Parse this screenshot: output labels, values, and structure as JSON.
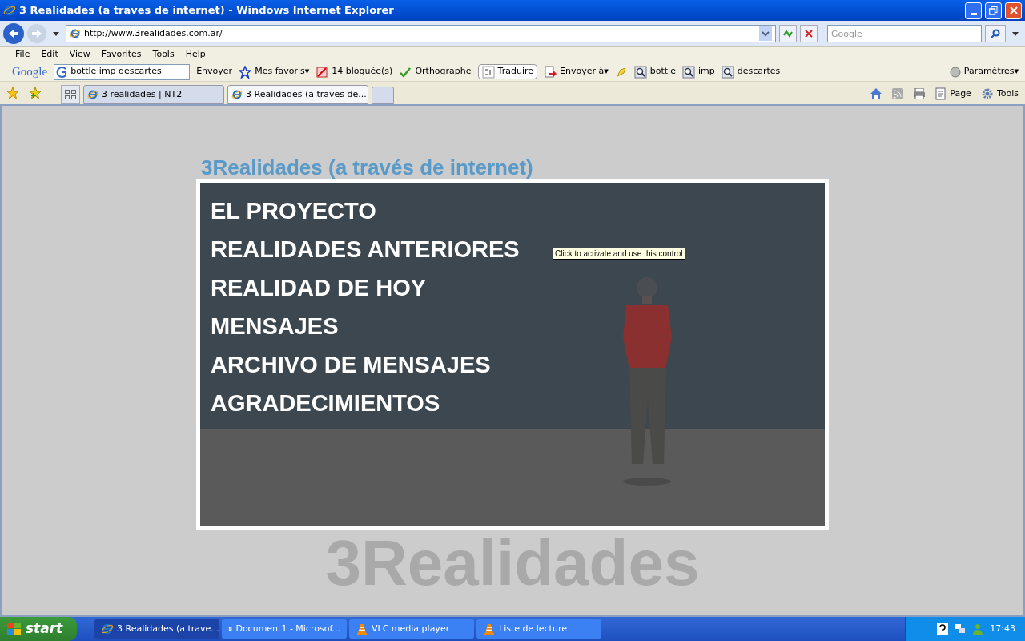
{
  "window": {
    "title": "3 Realidades (a traves de internet) - Windows Internet Explorer"
  },
  "address_bar": {
    "url": "http://www.3realidades.com.ar/"
  },
  "search": {
    "placeholder": "Google"
  },
  "menu": [
    "File",
    "Edit",
    "View",
    "Favorites",
    "Tools",
    "Help"
  ],
  "google_toolbar": {
    "logo": "Google",
    "query": "bottle imp descartes",
    "send": "Envoyer",
    "items": [
      {
        "kind": "star",
        "label": "Mes favoris▾"
      },
      {
        "kind": "blocked",
        "label": "14 bloquée(s)"
      },
      {
        "kind": "spell",
        "label": "Orthographe"
      },
      {
        "kind": "translate",
        "label": "Traduire"
      },
      {
        "kind": "send",
        "label": "Envoyer à▾"
      },
      {
        "kind": "highlight"
      },
      {
        "kind": "find",
        "label": "bottle"
      },
      {
        "kind": "find",
        "label": "imp"
      },
      {
        "kind": "find",
        "label": "descartes"
      }
    ],
    "settings": "Paramètres▾"
  },
  "tabs": [
    {
      "label": "3 realidades | NT2",
      "selected": false
    },
    {
      "label": "3 Realidades (a traves de...",
      "selected": true
    }
  ],
  "command_bar": {
    "page": "Page",
    "tools": "Tools"
  },
  "page": {
    "heading": "3Realidades (a través de internet)",
    "background_word": "3Realidades",
    "menu": [
      {
        "label": "EL PROYECTO"
      },
      {
        "label": "REALIDADES ANTERIORES"
      },
      {
        "label": "REALIDAD DE HOY"
      },
      {
        "label": "MENSAJES"
      },
      {
        "label": "ARCHIVO DE MENSAJES"
      },
      {
        "label": "AGRADECIMIENTOS"
      }
    ],
    "tooltip": "Click to activate and use this control"
  },
  "taskbar": {
    "start": "start",
    "items": [
      {
        "kind": "ie",
        "label": "3 Realidades (a trave...",
        "selected": true
      },
      {
        "kind": "word",
        "label": "Document1 - Microsof...",
        "selected": false
      },
      {
        "kind": "vlc",
        "label": "VLC media player",
        "selected": false
      },
      {
        "kind": "vlc",
        "label": "Liste de lecture",
        "selected": false
      }
    ],
    "clock": "17:43"
  }
}
